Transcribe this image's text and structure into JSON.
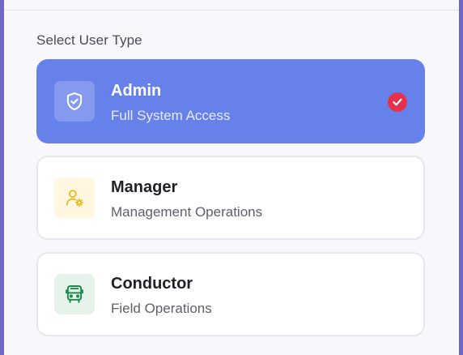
{
  "section_label": "Select User Type",
  "user_types": [
    {
      "title": "Admin",
      "subtitle": "Full System Access",
      "icon": "shield-check-icon",
      "selected": true
    },
    {
      "title": "Manager",
      "subtitle": "Management Operations",
      "icon": "user-gear-icon",
      "selected": false
    },
    {
      "title": "Conductor",
      "subtitle": "Field Operations",
      "icon": "bus-icon",
      "selected": false
    }
  ],
  "colors": {
    "selected_card": "#6781ea",
    "check_badge": "#e4324e",
    "manager_icon_bg": "#fff7df",
    "manager_icon": "#f1b81a",
    "conductor_icon_bg": "#e5f3ea",
    "conductor_icon": "#1f8a4c"
  }
}
